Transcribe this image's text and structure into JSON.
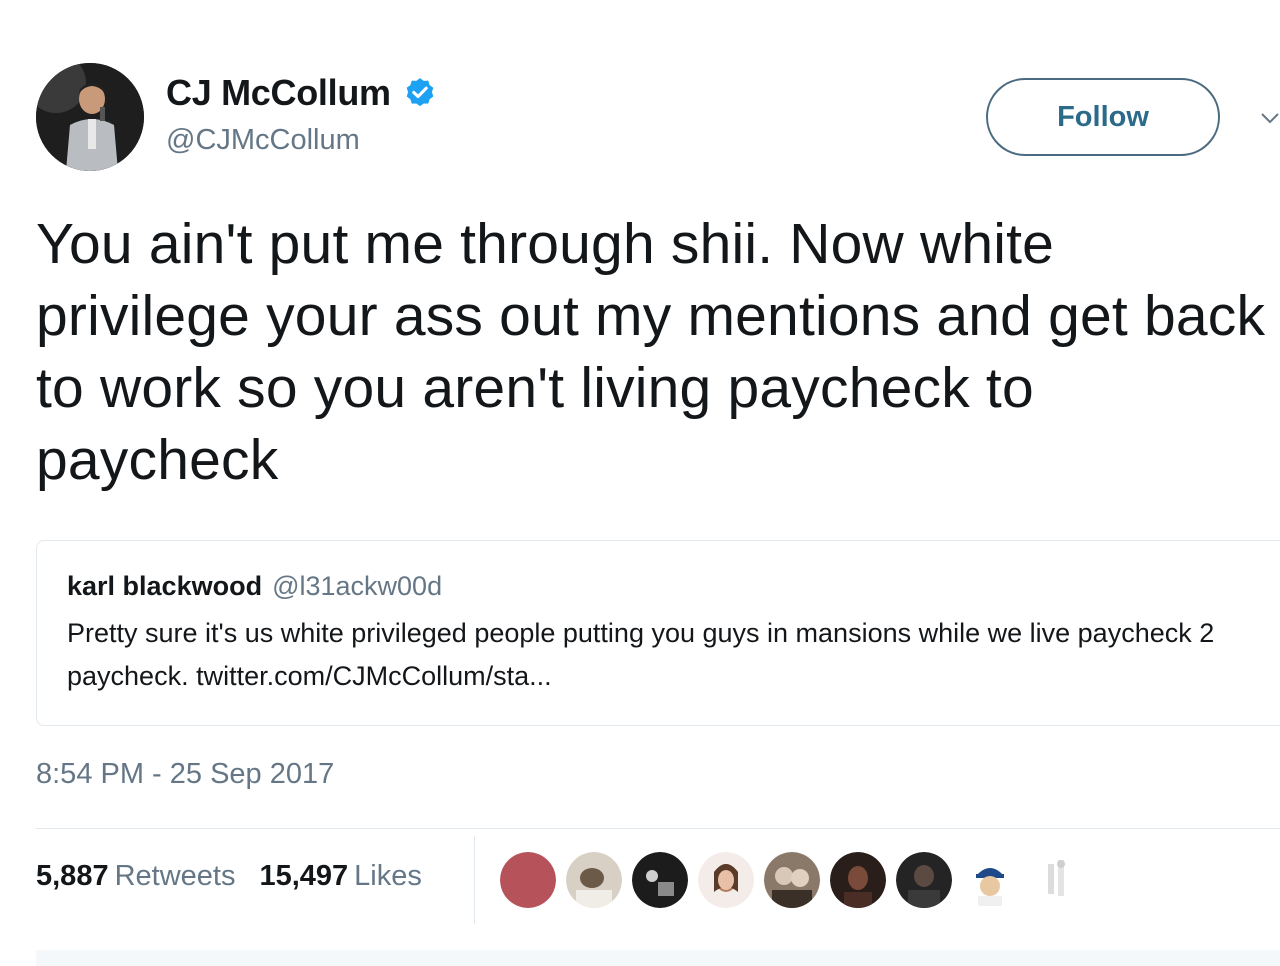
{
  "header": {
    "display_name": "CJ McCollum",
    "handle": "@CJMcCollum",
    "follow_label": "Follow",
    "verified_color": "#1da1f2"
  },
  "tweet": {
    "text": "You ain't put me through shii. Now white privilege your ass out my mentions and get back to work so you aren't living paycheck to paycheck"
  },
  "quoted_tweet": {
    "name": "karl blackwood",
    "handle": "@l31ackw00d",
    "text": "Pretty sure it's us white privileged people putting you guys in mansions while we live paycheck 2 paycheck. twitter.com/CJMcCollum/sta..."
  },
  "timestamp": "8:54 PM - 25 Sep 2017",
  "stats": {
    "retweets_count": "5,887",
    "retweets_label": "Retweets",
    "likes_count": "15,497",
    "likes_label": "Likes"
  },
  "icons": {
    "verified": "verified-badge-icon",
    "chevron": "chevron-down-icon"
  }
}
